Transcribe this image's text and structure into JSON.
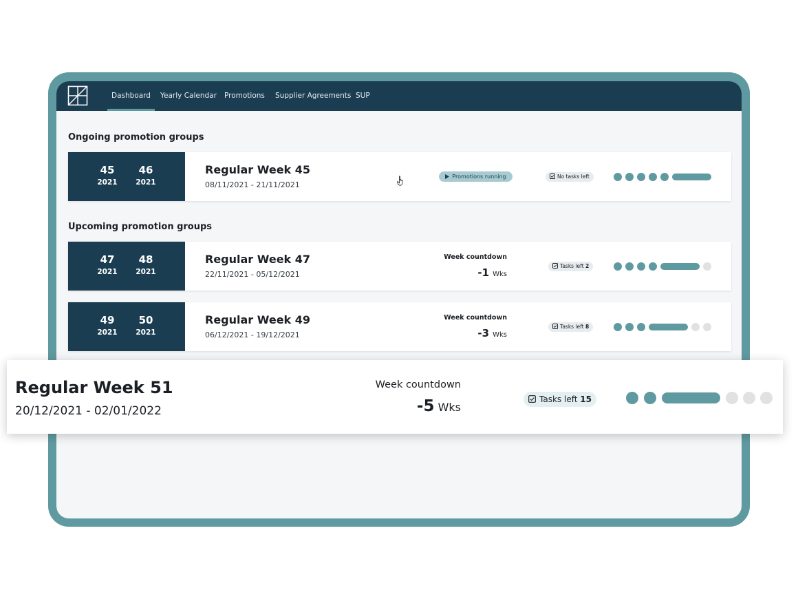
{
  "nav": {
    "items": [
      {
        "label": "Dashboard",
        "active": true
      },
      {
        "label": "Yearly Calendar",
        "active": false
      },
      {
        "label": "Promotions",
        "active": false
      },
      {
        "label": "Supplier Agreements",
        "active": false
      },
      {
        "label": "SUP",
        "active": false
      }
    ]
  },
  "ongoing": {
    "title": "Ongoing promotion groups",
    "card": {
      "week_start": "45",
      "year_start": "2021",
      "week_end": "46",
      "year_end": "2021",
      "title": "Regular Week 45",
      "dates": "08/11/2021 - 21/11/2021",
      "status_label": "Promotions running",
      "tasks_label": "No tasks left",
      "progress_steps_done": 6,
      "progress_steps_total": 6
    }
  },
  "upcoming": {
    "title": "Upcoming promotion groups",
    "cards": [
      {
        "week_start": "47",
        "year_start": "2021",
        "week_end": "48",
        "year_end": "2021",
        "title": "Regular Week 47",
        "dates": "22/11/2021 - 05/12/2021",
        "countdown_label": "Week countdown",
        "countdown_value": "-1",
        "countdown_unit": "Wks",
        "tasks_label": "Tasks left",
        "tasks_count": "2",
        "progress_steps_done": 5,
        "progress_steps_total": 6
      },
      {
        "week_start": "49",
        "year_start": "2021",
        "week_end": "50",
        "year_end": "2021",
        "title": "Regular Week 49",
        "dates": "06/12/2021 - 19/12/2021",
        "countdown_label": "Week countdown",
        "countdown_value": "-3",
        "countdown_unit": "Wks",
        "tasks_label": "Tasks left",
        "tasks_count": "8",
        "progress_steps_done": 4,
        "progress_steps_total": 6
      }
    ]
  },
  "highlight": {
    "title": "Regular Week 51",
    "dates": "20/12/2021 - 02/01/2022",
    "countdown_label": "Week countdown",
    "countdown_value": "-5",
    "countdown_unit": "Wks",
    "tasks_label": "Tasks left",
    "tasks_count": "15",
    "progress_steps_done": 3,
    "progress_steps_total": 6
  },
  "colors": {
    "frame": "#5f9aa0",
    "navbar": "#1b3d52",
    "progress_done": "#5f9aa0",
    "progress_todo": "#e1e1e1"
  },
  "icons": {
    "logo": "logo-mark-icon",
    "play": "play-icon",
    "checkbox": "checkbox-icon",
    "cursor": "hand-pointer-icon"
  }
}
